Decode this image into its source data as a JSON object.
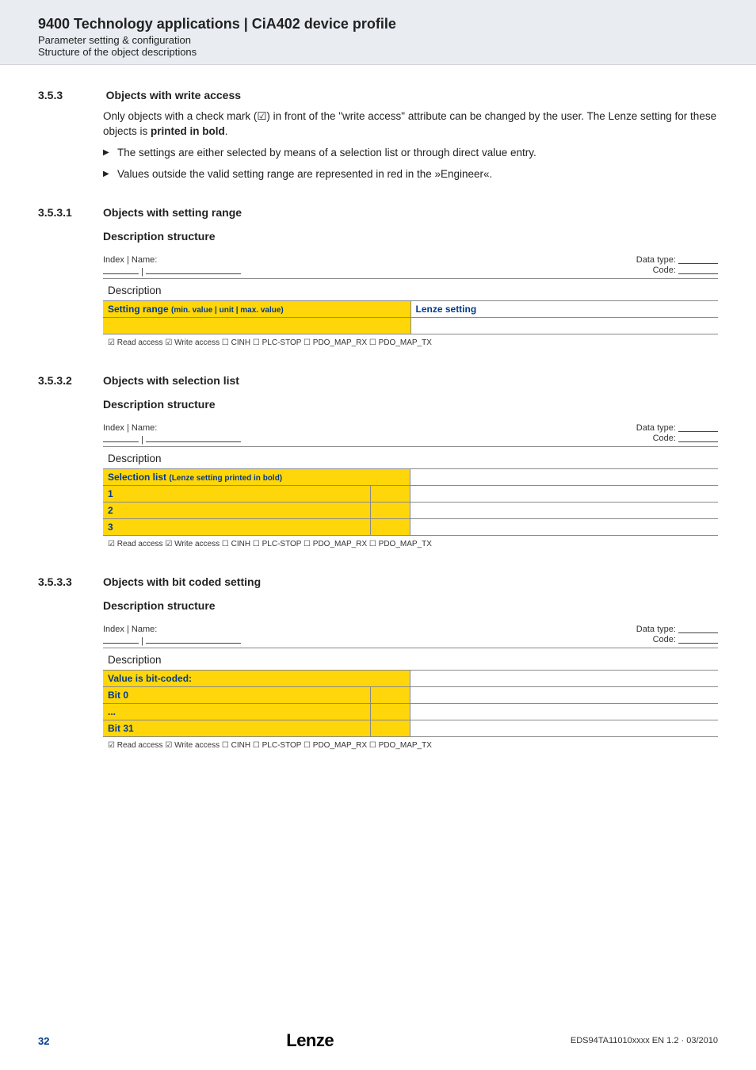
{
  "header": {
    "title": "9400 Technology applications | CiA402 device profile",
    "sub1": "Parameter setting & configuration",
    "sub2": "Structure of the object descriptions"
  },
  "s353": {
    "num": "3.5.3",
    "title": "Objects with write access",
    "para": "Only objects with a check mark (☑) in front of the \"write access\" attribute can be changed by the user. The Lenze setting for these objects is ",
    "para_bold": "printed in bold",
    "para_tail": ".",
    "b1": "The settings are either selected by means of a selection list or through direct value entry.",
    "b2": "Values outside the valid setting range are represented in red in the »Engineer«."
  },
  "blocks": [
    {
      "num": "3.5.3.1",
      "title": "Objects with setting range",
      "desc_hdr": "Description structure",
      "index_label": "Index | Name:",
      "dt_label": "Data type:",
      "code_label": "Code:",
      "desc_text": "Description",
      "hdr_left_main": "Setting range ",
      "hdr_left_small": "(min. value | unit | max. value)",
      "hdr_right": "Lenze setting",
      "mode": "range"
    },
    {
      "num": "3.5.3.2",
      "title": "Objects with selection list",
      "desc_hdr": "Description structure",
      "index_label": "Index | Name:",
      "dt_label": "Data type:",
      "code_label": "Code:",
      "desc_text": "Description",
      "hdr_left_main": "Selection list ",
      "hdr_left_small": "(Lenze setting printed in bold)",
      "mode": "selection",
      "rows": [
        "1",
        "2",
        "3"
      ]
    },
    {
      "num": "3.5.3.3",
      "title": "Objects with bit coded setting",
      "desc_hdr": "Description structure",
      "index_label": "Index | Name:",
      "dt_label": "Data type:",
      "code_label": "Code:",
      "desc_text": "Description",
      "hdr_left_main": "Value is bit-coded:",
      "mode": "bits",
      "rows": [
        "Bit 0",
        "...",
        "Bit 31"
      ]
    }
  ],
  "access_line": "☑ Read access   ☑ Write access   ☐ CINH   ☐ PLC-STOP   ☐ PDO_MAP_RX   ☐ PDO_MAP_TX",
  "footer": {
    "page": "32",
    "logo": "Lenze",
    "doc": "EDS94TA11010xxxx EN 1.2 · 03/2010"
  }
}
